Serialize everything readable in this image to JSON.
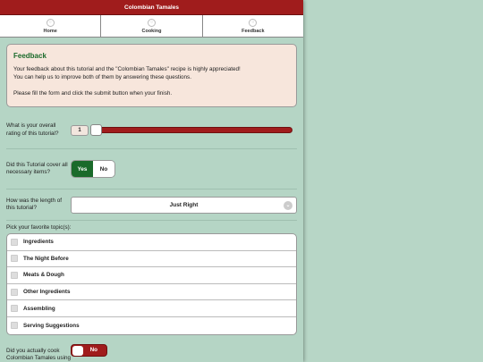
{
  "app": {
    "title": "Colombian Tamales"
  },
  "nav": [
    {
      "label": "Home",
      "icon": "home-icon"
    },
    {
      "label": "Cooking",
      "icon": "cooking-icon"
    },
    {
      "label": "Feedback",
      "icon": "feedback-icon"
    }
  ],
  "feedback": {
    "title": "Feedback",
    "line1": "Your feedback about this tutorial and the \"Colombian Tamales\" recipe is highly appreciated!",
    "line2": "You can help us to improve both of them by answering these questions.",
    "line3": "Please fill the form and click the submit button when your finish."
  },
  "rating": {
    "label": "What is your overall rating of this tutorial?",
    "value": "1",
    "level": 0.0
  },
  "coverage": {
    "label": "Did this Tutorial cover all necessary items?",
    "yes": "Yes",
    "no": "No",
    "selected": "Yes"
  },
  "length": {
    "label": "How was the length of this tutorial?",
    "value": "Just Right"
  },
  "topics": {
    "label": "Pick your favorite topic(s):",
    "items": [
      "Ingredients",
      "The Night Before",
      "Meats & Dough",
      "Other Ingredients",
      "Assembling",
      "Serving Suggestions"
    ]
  },
  "cooked": {
    "label": "Did you actually cook Colombian Tamales using this tutorial?",
    "value": "No"
  },
  "colors": {
    "accent": "#a01c1c",
    "positive": "#1a6a2a",
    "background": "#b7d6c6"
  }
}
